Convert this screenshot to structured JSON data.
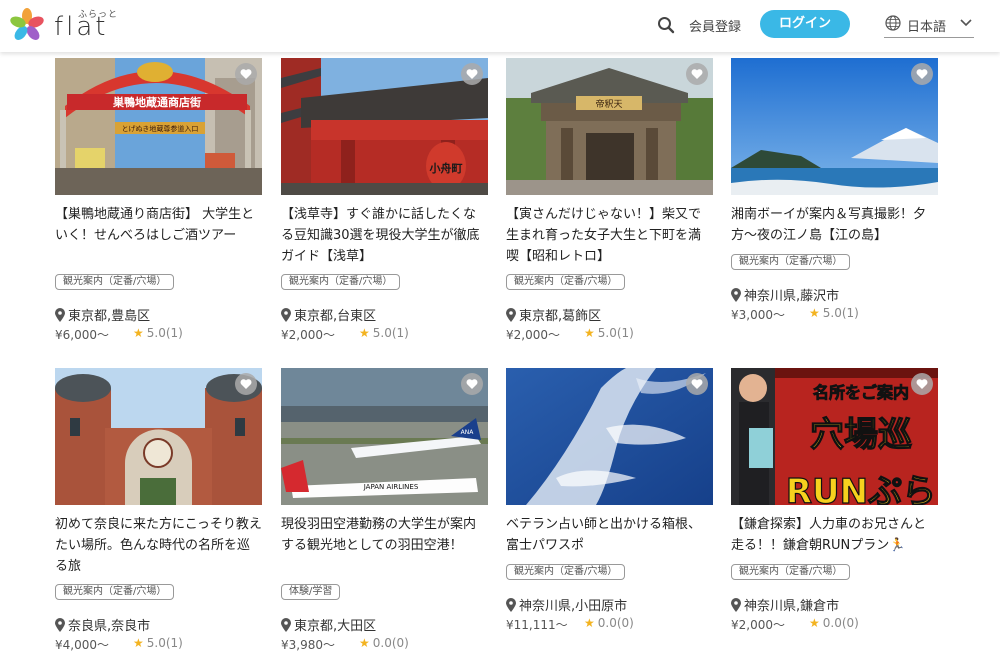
{
  "header": {
    "logo_ruby": "ふらっと",
    "logo_text": "flat",
    "signup_label": "会員登録",
    "login_label": "ログイン",
    "language_label": "日本語"
  },
  "colors": {
    "accent": "#3ab8e6",
    "star": "#f3b320"
  },
  "icons": {
    "search": "search-icon",
    "favorite": "heart-icon",
    "location": "pin-icon",
    "language": "globe-icon",
    "dropdown": "chevron-down-icon"
  },
  "cards": [
    {
      "title": "【巣鴨地蔵通り商店街】 大学生といく！せんべろはしご酒ツアー",
      "tag": "観光案内（定番/穴場）",
      "location": "東京都,豊島区",
      "price": "¥6,000〜",
      "rating": "5.0(1)"
    },
    {
      "title": "【浅草寺】すぐ誰かに話したくなる豆知識30選を現役大学生が徹底ガイド【浅草】",
      "tag": "観光案内（定番/穴場）",
      "location": "東京都,台東区",
      "price": "¥2,000〜",
      "rating": "5.0(1)"
    },
    {
      "title": "【寅さんだけじゃない！】柴又で生まれ育った女子大生と下町を満喫【昭和レトロ】",
      "tag": "観光案内（定番/穴場）",
      "location": "東京都,葛飾区",
      "price": "¥2,000〜",
      "rating": "5.0(1)"
    },
    {
      "title": "湘南ボーイが案内＆写真撮影！夕方〜夜の江ノ島【江の島】",
      "tag": "観光案内（定番/穴場）",
      "location": "神奈川県,藤沢市",
      "price": "¥3,000〜",
      "rating": "5.0(1)"
    },
    {
      "title": "初めて奈良に来た方にこっそり教えたい場所。色んな時代の名所を巡る旅",
      "tag": "観光案内（定番/穴場）",
      "location": "奈良県,奈良市",
      "price": "¥4,000〜",
      "rating": "5.0(1)"
    },
    {
      "title": "現役羽田空港勤務の大学生が案内する観光地としての羽田空港！",
      "tag": "体験/学習",
      "location": "東京都,大田区",
      "price": "¥3,980〜",
      "rating": "0.0(0)"
    },
    {
      "title": "ベテラン占い師と出かける箱根、富士パワスポ",
      "tag": "観光案内（定番/穴場）",
      "location": "神奈川県,小田原市",
      "price": "¥11,111〜",
      "rating": "0.0(0)"
    },
    {
      "title": "【鎌倉探索】人力車のお兄さんと走る！！鎌倉朝RUNプラン🏃",
      "tag": "観光案内（定番/穴場）",
      "location": "神奈川県,鎌倉市",
      "price": "¥2,000〜",
      "rating": "0.0(0)"
    }
  ],
  "image_texts": {
    "sugamo_sign": "巣鴨地蔵通商店街",
    "sugamo_subsign": "とげぬき地蔵尊参道入口",
    "sensoji_lantern": "小舟町",
    "shibamata_sign": "帝釈天",
    "airplane_livery": "JAPAN AIRLINES",
    "ana_livery": "ANA",
    "kamakura_line1": "名所をご案内",
    "kamakura_line2": "穴場巡",
    "kamakura_line3": "RUNぷら"
  }
}
